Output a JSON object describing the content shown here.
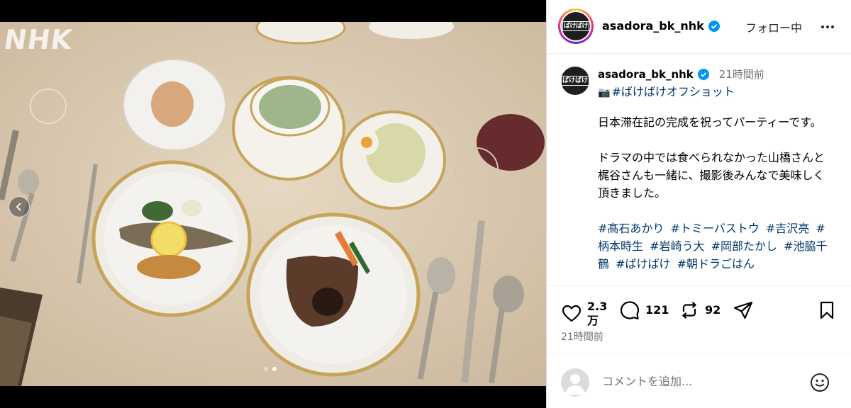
{
  "media": {
    "watermark": "NHK",
    "carousel_total": 2,
    "carousel_active": 2
  },
  "header": {
    "username": "asadora_bk_nhk",
    "avatar_text": "ばけばけ",
    "follow_label": "フォロー中"
  },
  "caption": {
    "username": "asadora_bk_nhk",
    "time": "21時間前",
    "tag": "#ばけばけオフショット",
    "paragraph1": "日本滞在記の完成を祝ってパーティーです。",
    "paragraph2": "ドラマの中では食べられなかった山橋さんと梶谷さんも一緒に、撮影後みんなで美味しく頂きました。",
    "hashtags": [
      "#髙石あかり",
      "#トミーバストウ",
      "#吉沢亮",
      "#柄本時生",
      "#岩崎う大",
      "#岡部たかし",
      "#池脇千鶴",
      "#ばけばけ",
      "#朝ドラごはん"
    ]
  },
  "actions": {
    "likes": "2.3万",
    "comments": "121",
    "reposts": "92",
    "post_age": "21時間前"
  },
  "comment": {
    "placeholder": "コメントを追加..."
  },
  "colors": {
    "link": "#00376b",
    "muted": "#737373",
    "verified": "#0095f6"
  }
}
